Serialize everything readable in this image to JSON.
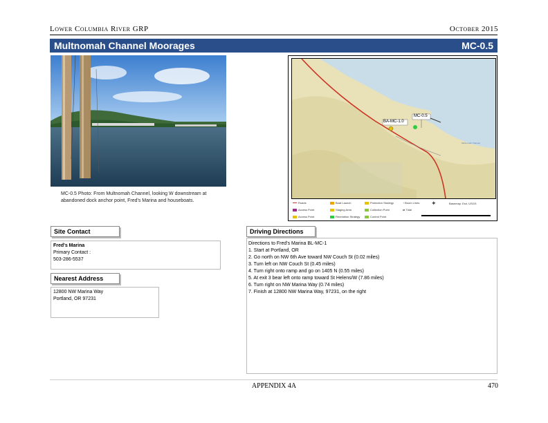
{
  "header": {
    "left": "Lower Columbia River GRP",
    "right": "October 2015"
  },
  "title_bar": {
    "title": "Multnomah Channel Moorages",
    "code": "MC-0.5"
  },
  "photo": {
    "caption": "MC-0.5 Photo: From Multnomah Channel, looking W downstream at abandoned dock anchor point, Fred's Marina and houseboats."
  },
  "map": {
    "label_site": "MC-0.5",
    "label_other": "BA-MC-1.0",
    "label_right": "Multnomah Channel",
    "legend": [
      {
        "label": "Roads",
        "color": "#c0392b"
      },
      {
        "label": "Boat Launch",
        "color": "#e6a800"
      },
      {
        "label": "Staging Area",
        "color": "#e6c200"
      },
      {
        "label": "Protection Strategy",
        "color": "#e6c200"
      },
      {
        "label": "Collection Point",
        "color": "#8dc63f"
      },
      {
        "label": "Control Point",
        "color": "#8dc63f"
      },
      {
        "label": "Access Point",
        "color": "#9b2d8e"
      },
      {
        "label": "Access Point",
        "color": "#e6c200"
      },
      {
        "label": "Recreation Strategy",
        "color": "#2ecc40"
      }
    ],
    "legend_extra": [
      "Boom Lines",
      "Tidal"
    ],
    "source": "Basemap: Esri, USGS"
  },
  "site_contact": {
    "label": "Site Contact",
    "name": "Fred's Marina",
    "primary": "Primary Contact :",
    "phone": "503-286-5537"
  },
  "nearest_address": {
    "label": "Nearest Address",
    "line1": "12800 NW Marina Way",
    "line2": "Portland, OR 97231"
  },
  "driving": {
    "label": "Driving Directions",
    "lines": [
      "Directions to Fred's Marina BL-MC-1",
      "1. Start at Portland, OR",
      "2. Go north on NW 6th Ave toward NW Couch St (0.02 miles)",
      "3. Turn left on NW Couch St (0.45 miles)",
      "4. Turn right onto ramp and go on 1405 N (0.55 miles)",
      "5. At exit 3 bear left onto ramp toward St Helens/W (7.86 miles)",
      "6. Turn right on NW Marina Way (0.74 miles)",
      "7. Finish at 12800 NW Marina Way, 97231, on the right"
    ]
  },
  "footer": {
    "center": "APPENDIX 4A",
    "page": "470"
  }
}
